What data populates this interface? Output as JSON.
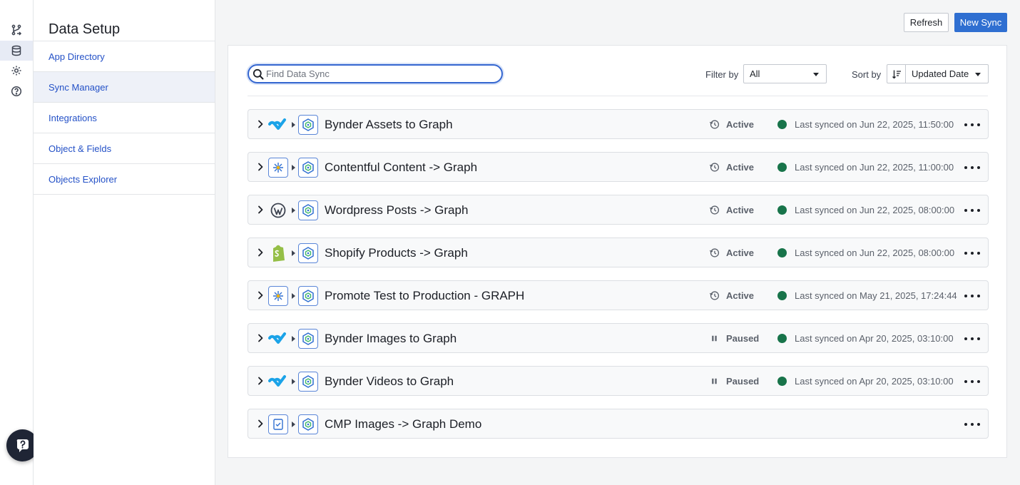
{
  "sidebar": {
    "title": "Data Setup",
    "items": [
      {
        "label": "App Directory"
      },
      {
        "label": "Sync Manager"
      },
      {
        "label": "Integrations"
      },
      {
        "label": "Object & Fields"
      },
      {
        "label": "Objects Explorer"
      }
    ],
    "active_index": 1
  },
  "rail": {
    "icons": [
      "workflow-icon",
      "database-icon",
      "gear-icon",
      "help-icon"
    ],
    "active": "database-icon"
  },
  "header": {
    "refresh_label": "Refresh",
    "new_sync_label": "New Sync"
  },
  "toolbar": {
    "search_placeholder": "Find Data Sync",
    "search_value": "",
    "filter_label": "Filter by",
    "filter_value": "All",
    "sort_label": "Sort by",
    "sort_value": "Updated Date"
  },
  "syncs": [
    {
      "source": "bynder",
      "name": "Bynder Assets to Graph",
      "status": "Active",
      "last_synced": "Last synced on Jun 22, 2025, 11:50:00"
    },
    {
      "source": "contentful",
      "name": "Contentful Content -> Graph",
      "status": "Active",
      "last_synced": "Last synced on Jun 22, 2025, 11:00:00"
    },
    {
      "source": "wordpress",
      "name": "Wordpress Posts -> Graph",
      "status": "Active",
      "last_synced": "Last synced on Jun 22, 2025, 08:00:00"
    },
    {
      "source": "shopify",
      "name": "Shopify Products -> Graph",
      "status": "Active",
      "last_synced": "Last synced on Jun 22, 2025, 08:00:00"
    },
    {
      "source": "contentful",
      "name": "Promote Test to Production - GRAPH",
      "status": "Active",
      "last_synced": "Last synced on May 21, 2025, 17:24:44"
    },
    {
      "source": "bynder",
      "name": "Bynder Images to Graph",
      "status": "Paused",
      "last_synced": "Last synced on Apr 20, 2025, 03:10:00"
    },
    {
      "source": "bynder",
      "name": "Bynder Videos to Graph",
      "status": "Paused",
      "last_synced": "Last synced on Apr 20, 2025, 03:10:00"
    },
    {
      "source": "cmp",
      "name": "CMP Images -> Graph Demo",
      "status": "",
      "last_synced": ""
    }
  ],
  "colors": {
    "accent": "#2f6fd1",
    "link": "#2451c7",
    "status_dot": "#18744a",
    "bynder": "#1ba3e8",
    "shopify": "#95bf47"
  }
}
